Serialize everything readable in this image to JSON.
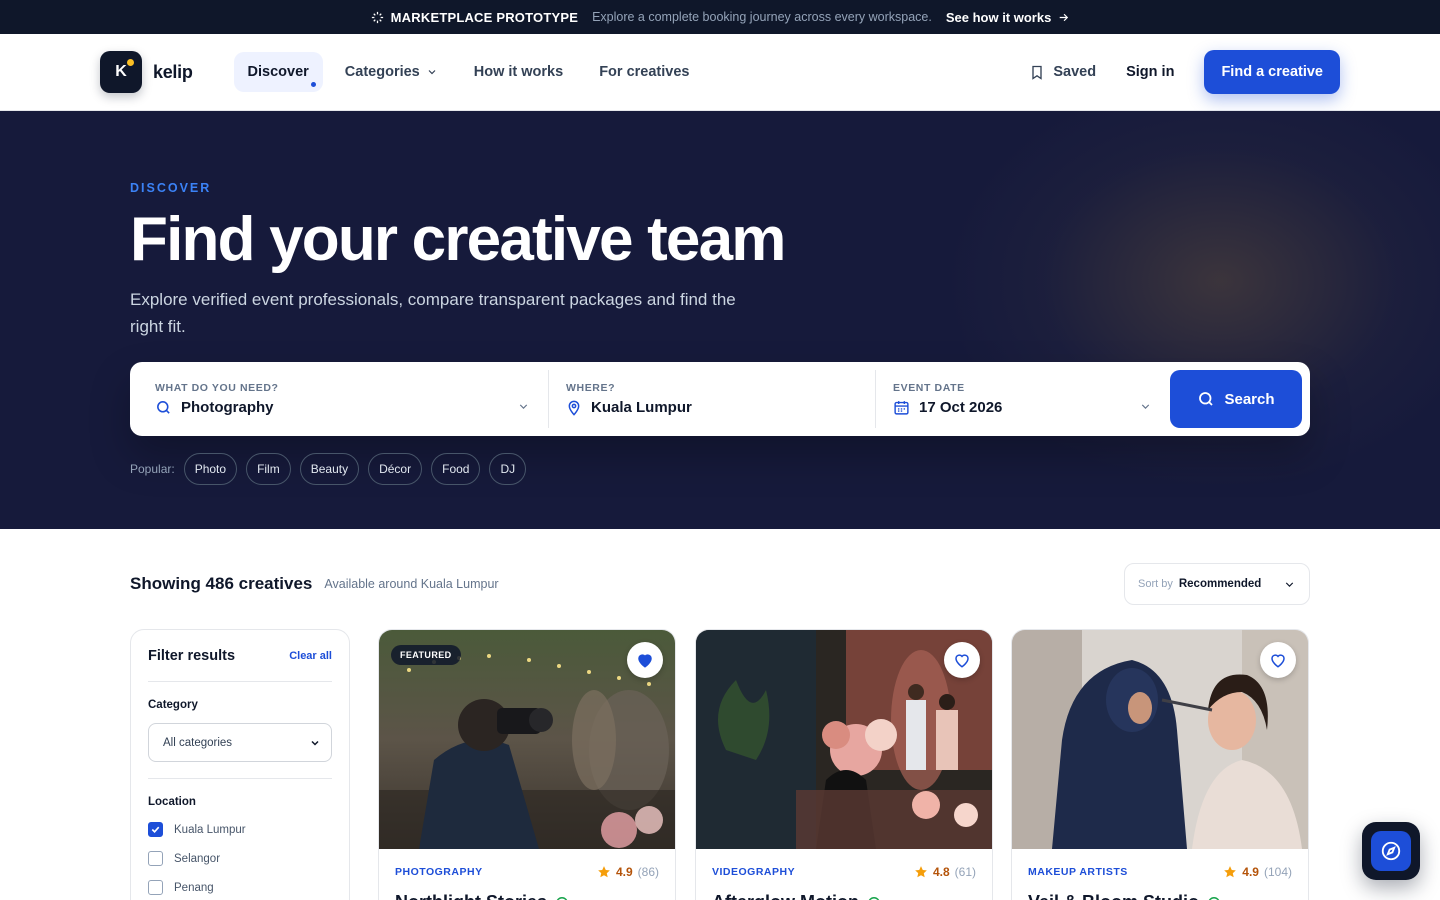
{
  "announcement": {
    "tag": "MARKETPLACE PROTOTYPE",
    "message": "Explore a complete booking journey across every workspace.",
    "link": "See how it works"
  },
  "nav": {
    "logo_letter": "K",
    "logo_text": "kelip",
    "links": [
      {
        "label": "Discover"
      },
      {
        "label": "Categories"
      },
      {
        "label": "How it works"
      },
      {
        "label": "For creatives"
      }
    ],
    "saved": "Saved",
    "signin": "Sign in",
    "cta": "Find a creative"
  },
  "hero": {
    "eyebrow": "DISCOVER",
    "title": "Find your creative team",
    "subtitle": "Explore verified event professionals, compare transparent packages and find the right fit."
  },
  "search": {
    "need_label": "WHAT DO YOU NEED?",
    "need_value": "Photography",
    "where_label": "WHERE?",
    "where_value": "Kuala Lumpur",
    "date_label": "EVENT DATE",
    "date_value": "17 Oct 2026",
    "button": "Search"
  },
  "popular": {
    "label": "Popular:",
    "chips": [
      "Photo",
      "Film",
      "Beauty",
      "Décor",
      "Food",
      "DJ"
    ]
  },
  "results": {
    "count": "Showing 486 creatives",
    "area": "Available around Kuala Lumpur",
    "sort_label": "Sort by",
    "sort_value": "Recommended"
  },
  "filter": {
    "title": "Filter results",
    "clear": "Clear all",
    "category_title": "Category",
    "category_value": "All categories",
    "location_title": "Location",
    "locations": [
      {
        "label": "Kuala Lumpur",
        "checked": true
      },
      {
        "label": "Selangor",
        "checked": false
      },
      {
        "label": "Penang",
        "checked": false
      }
    ]
  },
  "cards": [
    {
      "category": "PHOTOGRAPHY",
      "rating": "4.9",
      "reviews": "(86)",
      "name": "Northlight Stories",
      "featured": "FEATURED",
      "saved": true
    },
    {
      "category": "VIDEOGRAPHY",
      "rating": "4.8",
      "reviews": "(61)",
      "name": "Afterglow Motion",
      "saved": false
    },
    {
      "category": "MAKEUP ARTISTS",
      "rating": "4.9",
      "reviews": "(104)",
      "name": "Veil & Bloom Studio",
      "saved": false
    }
  ],
  "colors": {
    "brand": "#1d4ed8",
    "dark": "#0f172a",
    "hero_bg": "#161a3b",
    "star": "#f59e0b"
  }
}
